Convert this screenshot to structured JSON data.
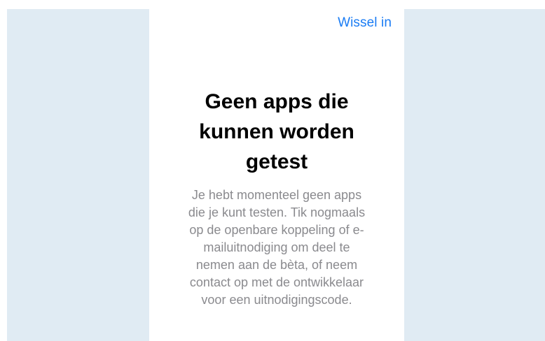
{
  "header": {
    "redeem_label": "Wissel in"
  },
  "empty_state": {
    "title": "Geen apps die kunnen worden getest",
    "message": "Je hebt momenteel geen apps die je kunt testen. Tik nogmaals op de openbare koppeling of e-mailuitnodiging om deel te nemen aan de bèta, of neem contact op met de ontwikkelaar voor een uitnodigingscode."
  },
  "colors": {
    "accent": "#1a7cf4",
    "background": "#e0ebf3",
    "panel": "#ffffff",
    "title": "#000000",
    "message": "#8a8a8e"
  }
}
